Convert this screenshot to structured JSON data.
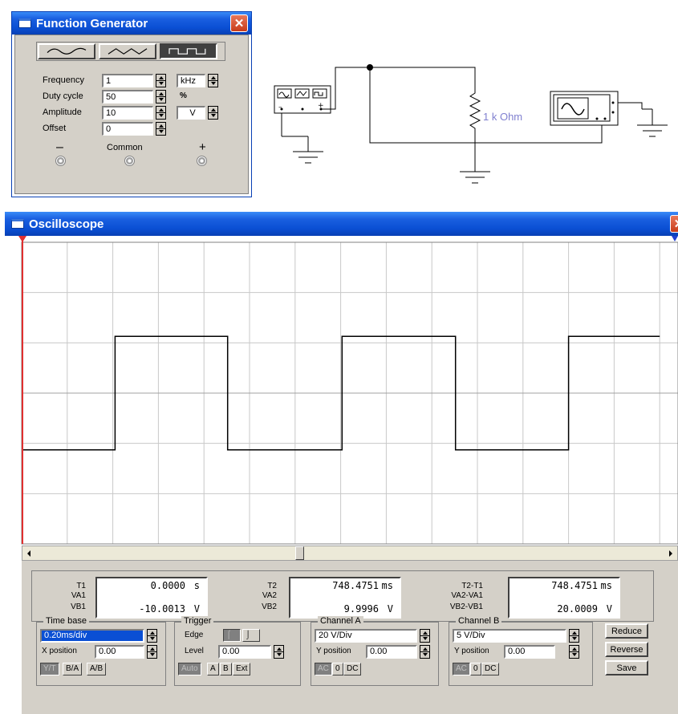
{
  "function_generator": {
    "title": "Function Generator",
    "waveforms": [
      "sine",
      "triangle",
      "square"
    ],
    "selected_waveform": "square",
    "fields": [
      {
        "label": "Frequency",
        "value": "1",
        "unit": "kHz"
      },
      {
        "label": "Duty cycle",
        "value": "50",
        "unit": "%"
      },
      {
        "label": "Amplitude",
        "value": "10",
        "unit": "V"
      },
      {
        "label": "Offset",
        "value": "0",
        "unit": ""
      }
    ],
    "terminals": {
      "minus": "–",
      "common": "Common",
      "plus": "+"
    }
  },
  "circuit": {
    "resistor_label": "1 k Ohm"
  },
  "oscilloscope": {
    "title": "Oscilloscope",
    "readouts": {
      "t1": {
        "label": "T1",
        "value": "0.0000",
        "unit": "s"
      },
      "va1": {
        "label": "VA1",
        "value": "",
        "unit": ""
      },
      "vb1": {
        "label": "VB1",
        "value": "-10.0013",
        "unit": "V"
      },
      "t2": {
        "label": "T2",
        "value": "748.4751",
        "unit": "ms"
      },
      "va2": {
        "label": "VA2",
        "value": "",
        "unit": ""
      },
      "vb2": {
        "label": "VB2",
        "value": "9.9996",
        "unit": "V"
      },
      "dt": {
        "label": "T2-T1",
        "value": "748.4751",
        "unit": "ms"
      },
      "dva": {
        "label": "VA2-VA1",
        "value": "",
        "unit": ""
      },
      "dvb": {
        "label": "VB2-VB1",
        "value": "20.0009",
        "unit": "V"
      }
    },
    "timebase": {
      "title": "Time base",
      "value": "0.20ms/div",
      "xpos_label": "X position",
      "xpos": "0.00",
      "buttons": [
        "Y/T",
        "B/A",
        "A/B"
      ]
    },
    "trigger": {
      "title": "Trigger",
      "edge_label": "Edge",
      "level_label": "Level",
      "level": "0.00",
      "buttons": [
        "Auto",
        "A",
        "B",
        "Ext"
      ]
    },
    "channel_a": {
      "title": "Channel A",
      "value": "20 V/Div",
      "ypos_label": "Y position",
      "ypos": "0.00",
      "buttons": [
        "AC",
        "0",
        "DC"
      ]
    },
    "channel_b": {
      "title": "Channel B",
      "value": "5 V/Div",
      "ypos_label": "Y position",
      "ypos": "0.00",
      "buttons": [
        "AC",
        "0",
        "DC"
      ]
    },
    "side_buttons": [
      "Reduce",
      "Reverse",
      "Save"
    ]
  },
  "chart_data": {
    "type": "line",
    "grid": true,
    "divisions": {
      "x": 14,
      "y": 6
    },
    "series": [
      {
        "color": "#000000",
        "x_div": [
          0,
          2.05,
          2.05,
          4.52,
          4.52,
          7.03,
          7.03,
          9.52,
          9.52,
          12.0,
          12.0,
          14.0
        ],
        "y_div": [
          -1,
          -1,
          1,
          1,
          -1,
          -1,
          1,
          1,
          -1,
          -1,
          1,
          1
        ]
      }
    ],
    "cursor_colors": {
      "t1": "#e03030",
      "t2": "#2040d0"
    }
  }
}
